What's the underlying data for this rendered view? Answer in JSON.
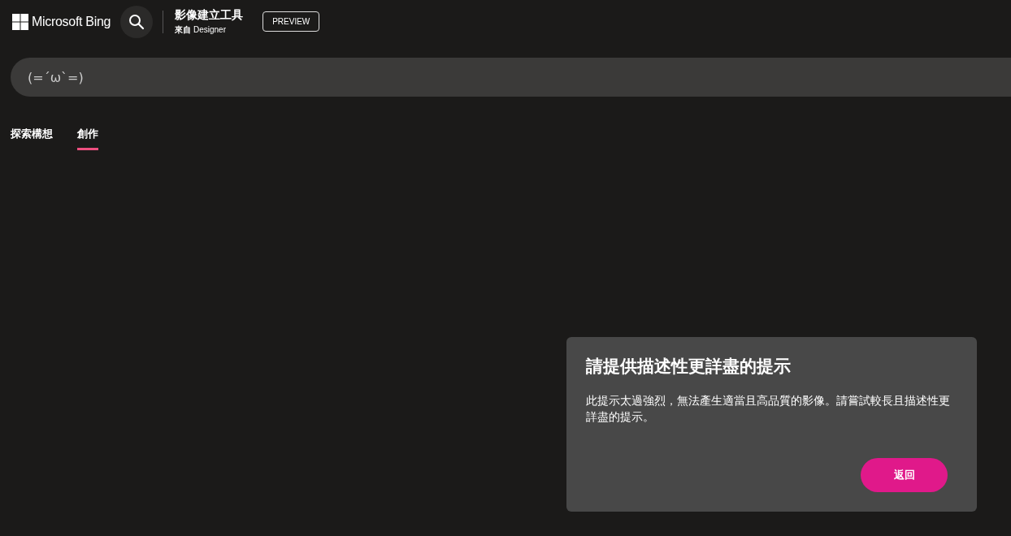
{
  "header": {
    "brand": "Microsoft Bing",
    "title": "影像建立工具",
    "subtitle": "**來自** Designer",
    "badge": "PREVIEW"
  },
  "prompt": {
    "value": "(=´ω`=)"
  },
  "tabs": [
    {
      "label": "探索構想",
      "selected": false
    },
    {
      "label": "創作",
      "selected": true
    }
  ],
  "dialog": {
    "title": "請提供描述性更詳盡的提示",
    "message": "此提示太過強烈，無法產生適當且高品質的影像。請嘗試較長且描述性更詳盡的提示。",
    "button": "返回"
  }
}
